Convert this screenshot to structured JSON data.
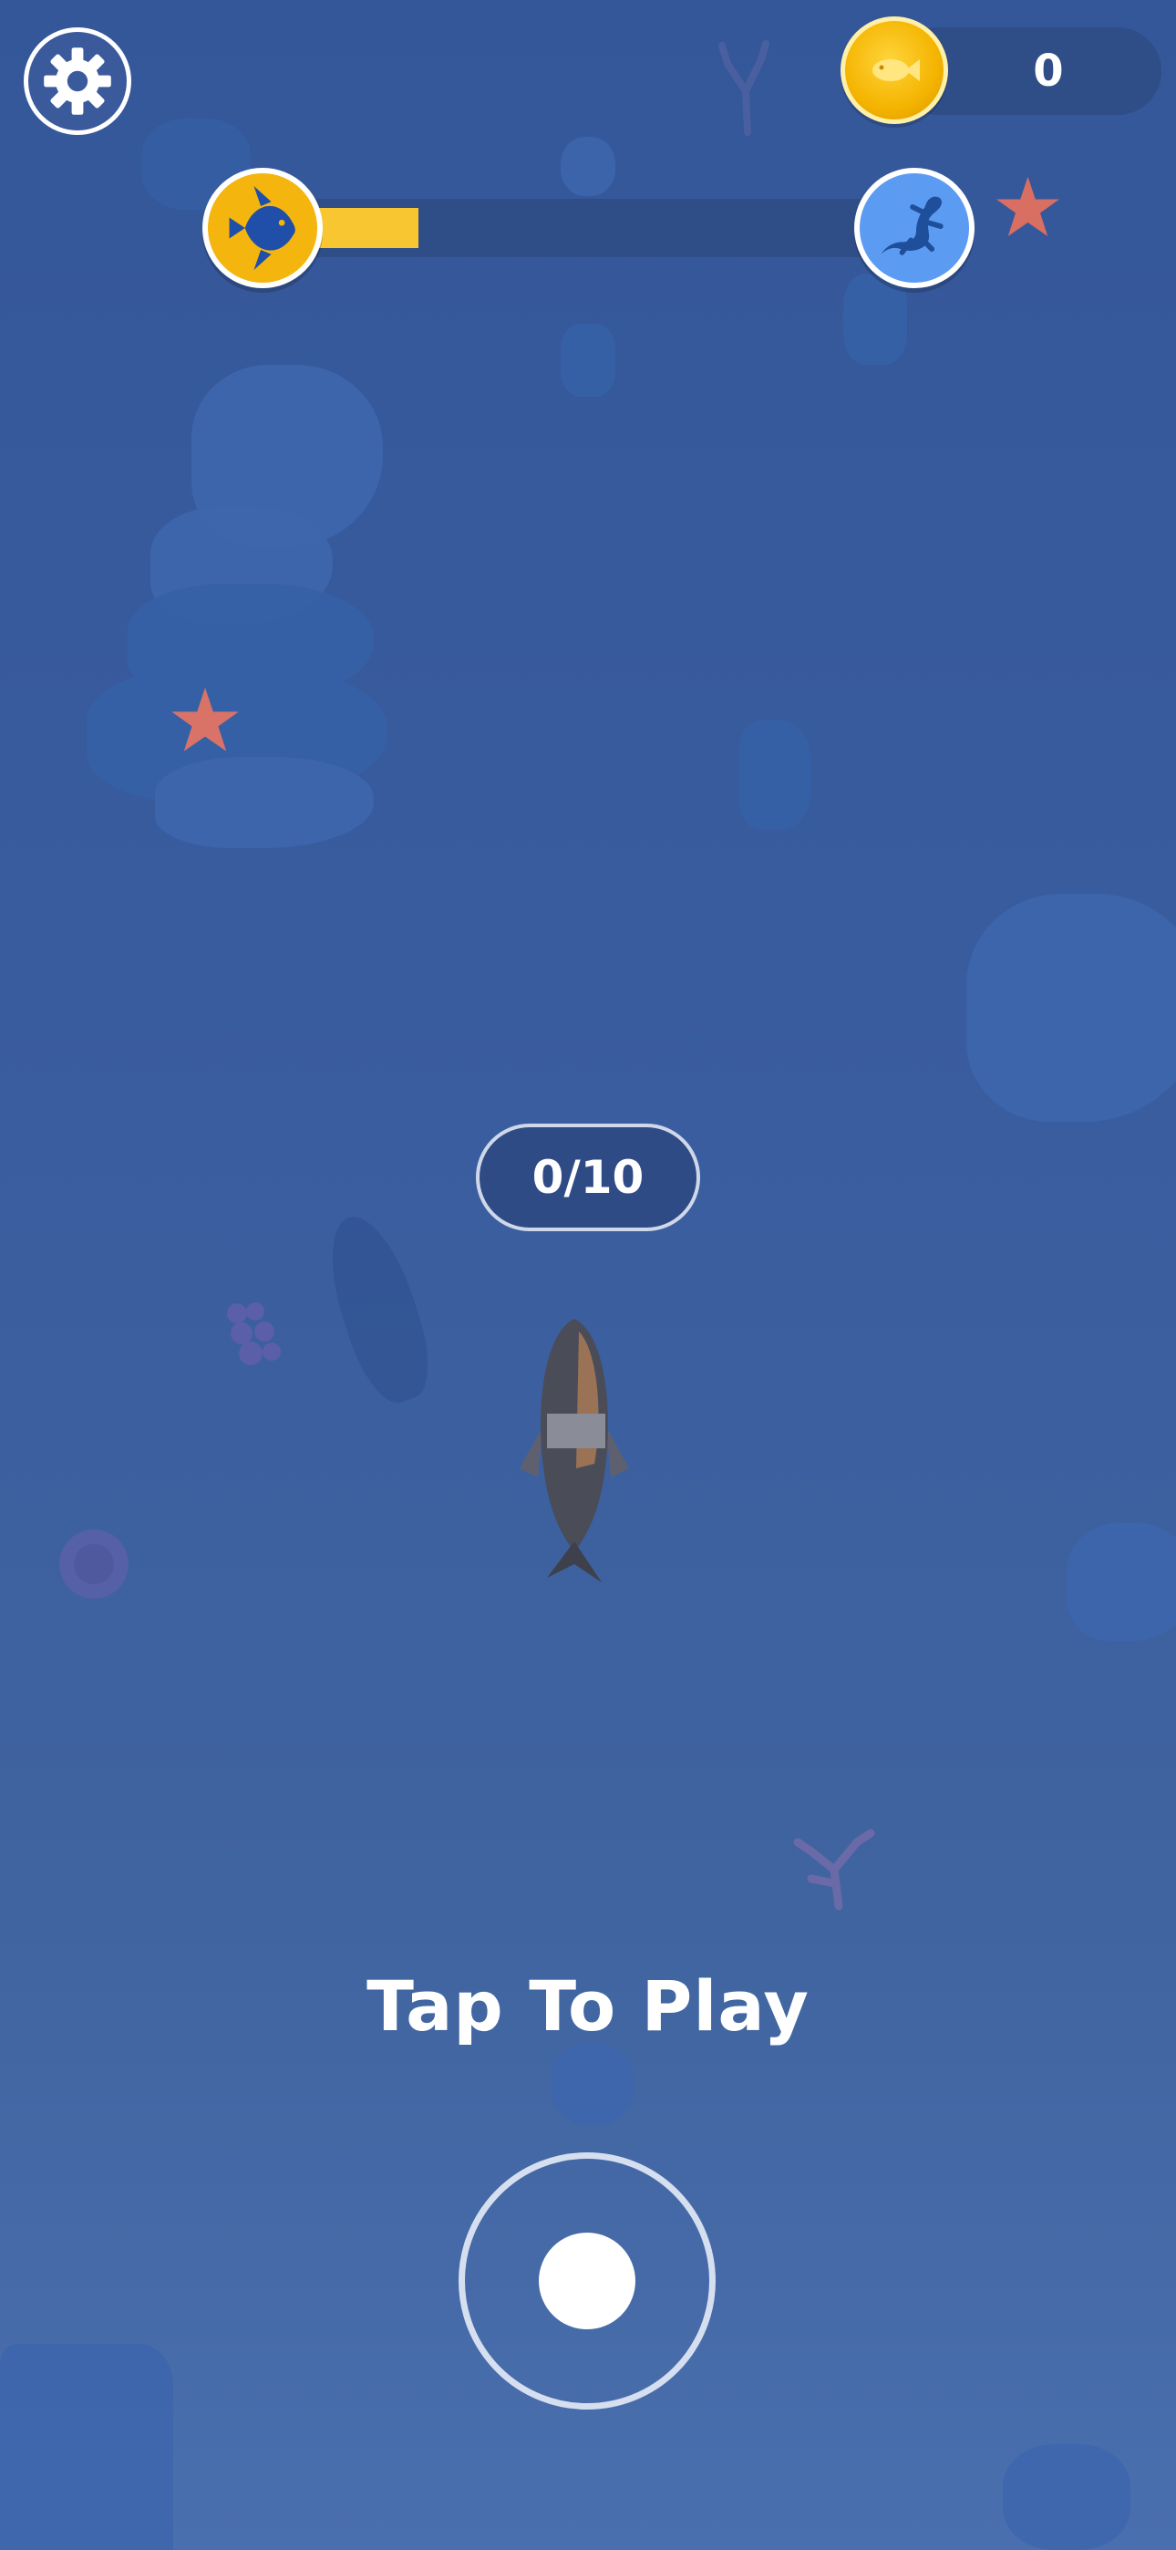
{
  "hud": {
    "coin_count": "0",
    "level_progress": 0.22,
    "start_animal_icon": "angelfish-icon",
    "goal_animal_icon": "lizard-icon",
    "settings_icon": "gear-icon"
  },
  "game": {
    "fish_counter": "0/10",
    "prompt": "Tap To Play"
  },
  "colors": {
    "water": "#3a5d9f",
    "progress_fill": "#f8c630",
    "coin": "#f4b400",
    "goal_badge": "#5b9cf2"
  }
}
